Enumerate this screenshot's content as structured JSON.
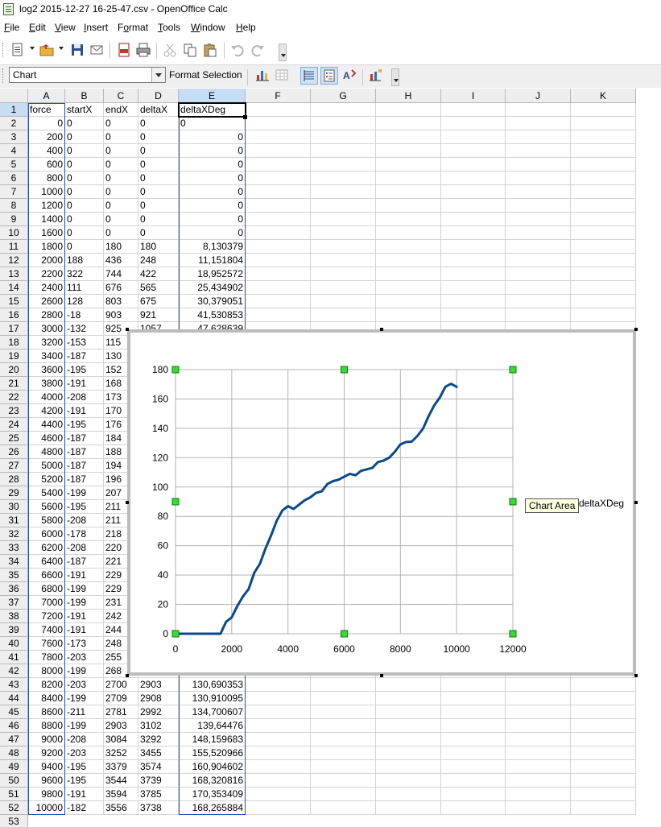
{
  "window": {
    "title": "log2 2015-12-27 16-25-47.csv - OpenOffice Calc"
  },
  "menu": [
    {
      "id": "file",
      "pre": "",
      "hot": "F",
      "post": "ile"
    },
    {
      "id": "edit",
      "pre": "",
      "hot": "E",
      "post": "dit"
    },
    {
      "id": "view",
      "pre": "",
      "hot": "V",
      "post": "iew"
    },
    {
      "id": "insert",
      "pre": "",
      "hot": "I",
      "post": "nsert"
    },
    {
      "id": "format",
      "pre": "F",
      "hot": "o",
      "post": "rmat"
    },
    {
      "id": "tools",
      "pre": "",
      "hot": "T",
      "post": "ools"
    },
    {
      "id": "window",
      "pre": "",
      "hot": "W",
      "post": "indow"
    },
    {
      "id": "help",
      "pre": "",
      "hot": "H",
      "post": "elp"
    }
  ],
  "toolbar2": {
    "name_box": "Chart",
    "format_selection": "Format Selection"
  },
  "columns": [
    "A",
    "B",
    "C",
    "D",
    "E",
    "F",
    "G",
    "H",
    "I",
    "J",
    "K"
  ],
  "selected_column": "E",
  "selected_row": 1,
  "headers": [
    "force",
    "startX",
    "endX",
    "deltaX",
    "deltaXDeg"
  ],
  "rows": [
    [
      "0",
      "0",
      "0",
      "0",
      "0"
    ],
    [
      "200",
      "0",
      "0",
      "0",
      "0"
    ],
    [
      "400",
      "0",
      "0",
      "0",
      "0"
    ],
    [
      "600",
      "0",
      "0",
      "0",
      "0"
    ],
    [
      "800",
      "0",
      "0",
      "0",
      "0"
    ],
    [
      "1000",
      "0",
      "0",
      "0",
      "0"
    ],
    [
      "1200",
      "0",
      "0",
      "0",
      "0"
    ],
    [
      "1400",
      "0",
      "0",
      "0",
      "0"
    ],
    [
      "1600",
      "0",
      "0",
      "0",
      "0"
    ],
    [
      "1800",
      "0",
      "180",
      "180",
      "8,130379"
    ],
    [
      "2000",
      "188",
      "436",
      "248",
      "11,151804"
    ],
    [
      "2200",
      "322",
      "744",
      "422",
      "18,952572"
    ],
    [
      "2400",
      "111",
      "676",
      "565",
      "25,434902"
    ],
    [
      "2600",
      "128",
      "803",
      "675",
      "30,379051"
    ],
    [
      "2800",
      "-18",
      "903",
      "921",
      "41,530853"
    ],
    [
      "3000",
      "-132",
      "925",
      "1057",
      "47,628639"
    ],
    [
      "3200",
      "-153",
      "115",
      "",
      ""
    ],
    [
      "3400",
      "-187",
      "130",
      "",
      ""
    ],
    [
      "3600",
      "-195",
      "152",
      "",
      ""
    ],
    [
      "3800",
      "-191",
      "168",
      "",
      ""
    ],
    [
      "4000",
      "-208",
      "173",
      "",
      ""
    ],
    [
      "4200",
      "-191",
      "170",
      "",
      ""
    ],
    [
      "4400",
      "-195",
      "176",
      "",
      ""
    ],
    [
      "4600",
      "-187",
      "184",
      "",
      ""
    ],
    [
      "4800",
      "-187",
      "188",
      "",
      ""
    ],
    [
      "5000",
      "-187",
      "194",
      "",
      ""
    ],
    [
      "5200",
      "-187",
      "196",
      "",
      ""
    ],
    [
      "5400",
      "-199",
      "207",
      "",
      ""
    ],
    [
      "5600",
      "-195",
      "211",
      "",
      ""
    ],
    [
      "5800",
      "-208",
      "211",
      "",
      ""
    ],
    [
      "6000",
      "-178",
      "218",
      "",
      ""
    ],
    [
      "6200",
      "-208",
      "220",
      "",
      ""
    ],
    [
      "6400",
      "-187",
      "221",
      "",
      ""
    ],
    [
      "6600",
      "-191",
      "229",
      "",
      ""
    ],
    [
      "6800",
      "-199",
      "229",
      "",
      ""
    ],
    [
      "7000",
      "-199",
      "231",
      "",
      ""
    ],
    [
      "7200",
      "-191",
      "242",
      "",
      ""
    ],
    [
      "7400",
      "-191",
      "244",
      "",
      ""
    ],
    [
      "7600",
      "-173",
      "248",
      "",
      ""
    ],
    [
      "7800",
      "-203",
      "255",
      "",
      ""
    ],
    [
      "8000",
      "-199",
      "268",
      "",
      ""
    ],
    [
      "8200",
      "-203",
      "2700",
      "2903",
      "130,690353"
    ],
    [
      "8400",
      "-199",
      "2709",
      "2908",
      "130,910095"
    ],
    [
      "8600",
      "-211",
      "2781",
      "2992",
      "134,700607"
    ],
    [
      "8800",
      "-199",
      "2903",
      "3102",
      "139,64476"
    ],
    [
      "9000",
      "-208",
      "3084",
      "3292",
      "148,159683"
    ],
    [
      "9200",
      "-203",
      "3252",
      "3455",
      "155,520966"
    ],
    [
      "9400",
      "-195",
      "3379",
      "3574",
      "160,904602"
    ],
    [
      "9600",
      "-195",
      "3544",
      "3739",
      "168,320816"
    ],
    [
      "9800",
      "-191",
      "3594",
      "3785",
      "170,353409"
    ],
    [
      "10000",
      "-182",
      "3556",
      "3738",
      "168,265884"
    ]
  ],
  "extra_row_label": "53",
  "chart": {
    "tooltip": "Chart Area",
    "legend_label": "deltaXDeg"
  },
  "chart_data": {
    "type": "line",
    "xlim": [
      0,
      12000
    ],
    "ylim": [
      0,
      180
    ],
    "x_ticks": [
      0,
      2000,
      4000,
      6000,
      8000,
      10000,
      12000
    ],
    "y_ticks": [
      0,
      20,
      40,
      60,
      80,
      100,
      120,
      140,
      160,
      180
    ],
    "grid": true,
    "legend_placement": "right",
    "series_color": "#0a4a8c",
    "series": [
      {
        "name": "deltaXDeg",
        "x": [
          0,
          200,
          400,
          600,
          800,
          1000,
          1200,
          1400,
          1600,
          1800,
          2000,
          2200,
          2400,
          2600,
          2800,
          3000,
          3200,
          3400,
          3600,
          3800,
          4000,
          4200,
          4400,
          4600,
          4800,
          5000,
          5200,
          5400,
          5600,
          5800,
          6000,
          6200,
          6400,
          6600,
          6800,
          7000,
          7200,
          7400,
          7600,
          7800,
          8000,
          8200,
          8400,
          8600,
          8800,
          9000,
          9200,
          9400,
          9600,
          9800,
          10000
        ],
        "y": [
          0,
          0,
          0,
          0,
          0,
          0,
          0,
          0,
          0,
          8.13,
          11.15,
          18.95,
          25.43,
          30.38,
          41.53,
          47.63,
          58,
          67,
          77,
          84,
          87,
          85,
          88,
          91,
          93,
          96,
          97,
          102,
          104,
          105,
          107,
          109,
          108,
          111,
          112,
          113,
          117,
          118,
          120,
          124,
          129,
          130.69,
          130.91,
          134.7,
          139.64,
          148.16,
          155.52,
          160.9,
          168.32,
          170.35,
          168.27
        ]
      }
    ]
  }
}
